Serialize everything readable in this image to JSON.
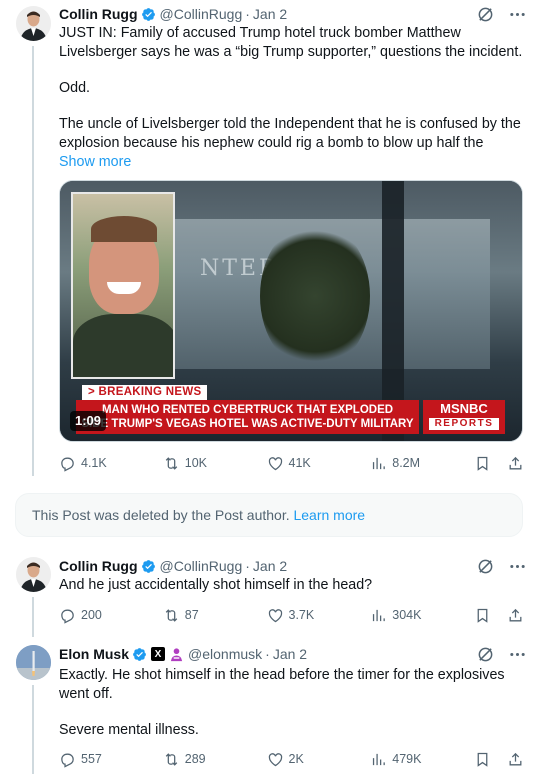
{
  "colors": {
    "accent": "#1d9bf0",
    "verified": "#1d9bf0",
    "muted": "#536471",
    "breaking": "#c4161c"
  },
  "posts": [
    {
      "author": "Collin Rugg",
      "handle": "@CollinRugg",
      "date": "Jan 2",
      "lines": [
        "JUST IN: Family of accused Trump hotel truck bomber Matthew Livelsberger says he was a “big Trump supporter,” questions the incident.",
        "Odd.",
        "The uncle of Livelsberger told the Independent that he is confused by the explosion because his nephew could rig a bomb to blow up half the"
      ],
      "show_more": "Show more",
      "video": {
        "duration": "1:09",
        "sign_text": "NTER  TION",
        "breaking_tag": "> BREAKING NEWS",
        "headline_1": "MAN WHO RENTED CYBERTRUCK THAT EXPLODED",
        "headline_2": "SIDE TRUMP'S VEGAS HOTEL WAS ACTIVE-DUTY MILITARY",
        "network": "MSNBC",
        "network_sub": "REPORTS"
      },
      "stats": {
        "replies": "4.1K",
        "reposts": "10K",
        "likes": "41K",
        "views": "8.2M"
      }
    },
    {
      "author": "Collin Rugg",
      "handle": "@CollinRugg",
      "date": "Jan 2",
      "lines": [
        "And he just accidentally shot himself in the head?"
      ],
      "stats": {
        "replies": "200",
        "reposts": "87",
        "likes": "3.7K",
        "views": "304K"
      }
    },
    {
      "author": "Elon Musk",
      "handle": "@elonmusk",
      "date": "Jan 2",
      "lines": [
        "Exactly. He shot himself in the head before the timer for the explosives went off.",
        "Severe mental illness."
      ],
      "stats": {
        "replies": "557",
        "reposts": "289",
        "likes": "2K",
        "views": "479K"
      }
    }
  ],
  "deleted_notice": {
    "text": "This Post was deleted by the Post author.",
    "link": "Learn more"
  },
  "icons": [
    "verified-icon",
    "grok-icon",
    "more-icon",
    "reply-icon",
    "repost-icon",
    "like-icon",
    "views-icon",
    "bookmark-icon",
    "share-icon",
    "x-badge-icon",
    "affiliate-icon"
  ]
}
